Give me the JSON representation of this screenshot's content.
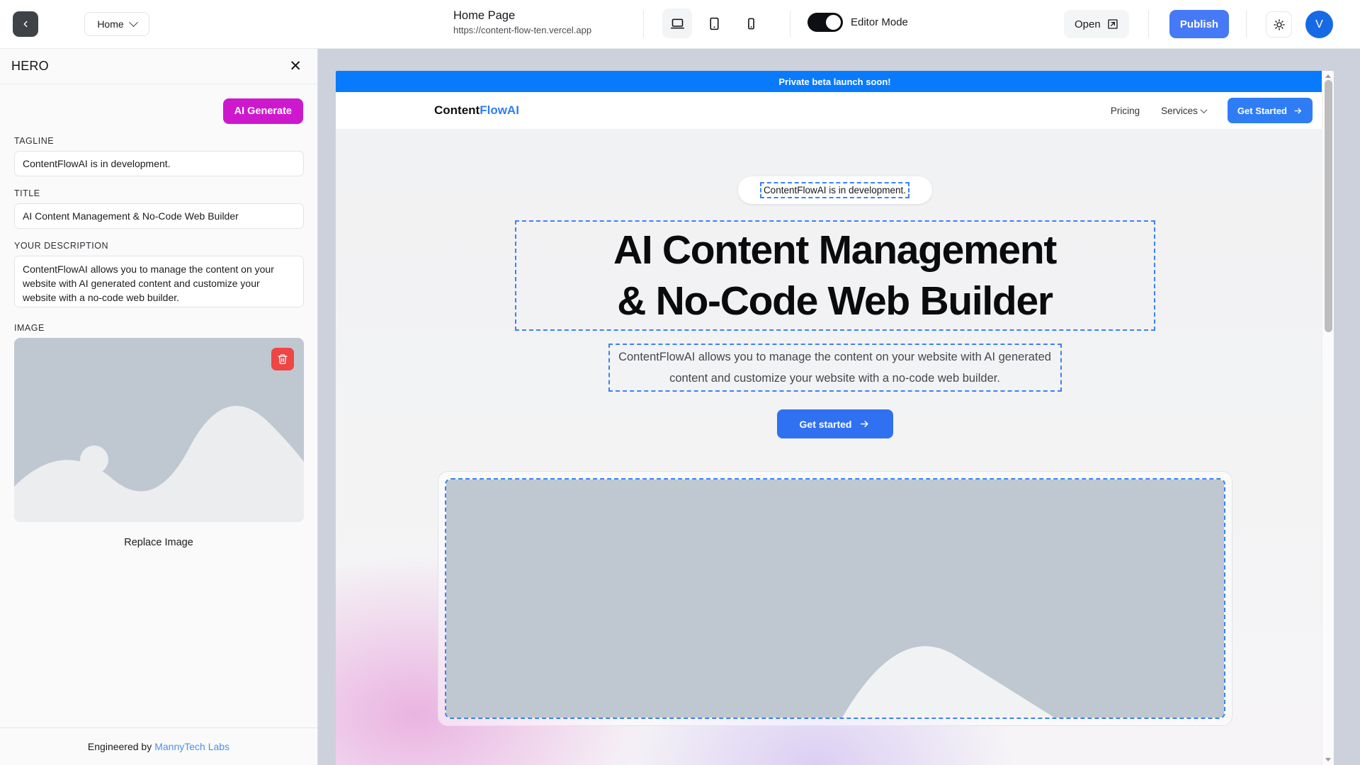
{
  "topbar": {
    "back_icon": "chevron-left-icon",
    "page_selector": {
      "label": "Home",
      "icon": "chevron-down-icon"
    },
    "site": {
      "title": "Home Page",
      "url": "https://content-flow-ten.vercel.app"
    },
    "devices": [
      {
        "name": "desktop",
        "icon": "laptop-icon",
        "active": true
      },
      {
        "name": "tablet",
        "icon": "tablet-icon",
        "active": false
      },
      {
        "name": "mobile",
        "icon": "phone-icon",
        "active": false
      }
    ],
    "editor_mode": {
      "label": "Editor Mode",
      "enabled": true
    },
    "open_label": "Open",
    "open_icon": "external-link-icon",
    "publish_label": "Publish",
    "theme_icon": "sun-icon",
    "avatar_initial": "V",
    "accent_blue": "#4579f5",
    "avatar_blue": "#176ae5"
  },
  "sidebar": {
    "panel_title": "HERO",
    "close_icon": "close-icon",
    "ai_generate_label": "AI Generate",
    "ai_generate_color": "#ce18ce",
    "fields": {
      "tagline_label": "TAGLINE",
      "tagline_value": "ContentFlowAI is in development.",
      "title_label": "TITLE",
      "title_value": "AI Content Management & No-Code Web Builder",
      "description_label": "YOUR DESCRIPTION",
      "description_value": "ContentFlowAI allows you to manage the content on your website with AI generated content and customize your website with a no-code web builder.",
      "image_label": "IMAGE"
    },
    "delete_icon": "trash-icon",
    "delete_color": "#ee4545",
    "replace_image_label": "Replace Image",
    "footer_prefix": "Engineered by",
    "footer_link": "MannyTech Labs",
    "footer_link_color": "#4a90f0"
  },
  "preview": {
    "announcement": "Private beta launch soon!",
    "announcement_color": "#0a7afc",
    "logo_black": "Content",
    "logo_blue": "FlowAI",
    "logo_blue_color": "#2f7df5",
    "nav": [
      {
        "label": "Pricing",
        "has_chevron": false
      },
      {
        "label": "Services",
        "has_chevron": true
      }
    ],
    "nav_cta": {
      "label": "Get Started",
      "icon": "arrow-right-icon"
    },
    "hero": {
      "tagline": "ContentFlowAI is in development.",
      "title_line1": "AI Content Management",
      "title_line2": "& No-Code Web Builder",
      "description": "ContentFlowAI allows you to manage the content on your website with AI generated content and customize your website with a no-code web builder.",
      "cta_label": "Get started",
      "cta_icon": "arrow-right-icon",
      "selection_color": "#3b82f6"
    }
  }
}
